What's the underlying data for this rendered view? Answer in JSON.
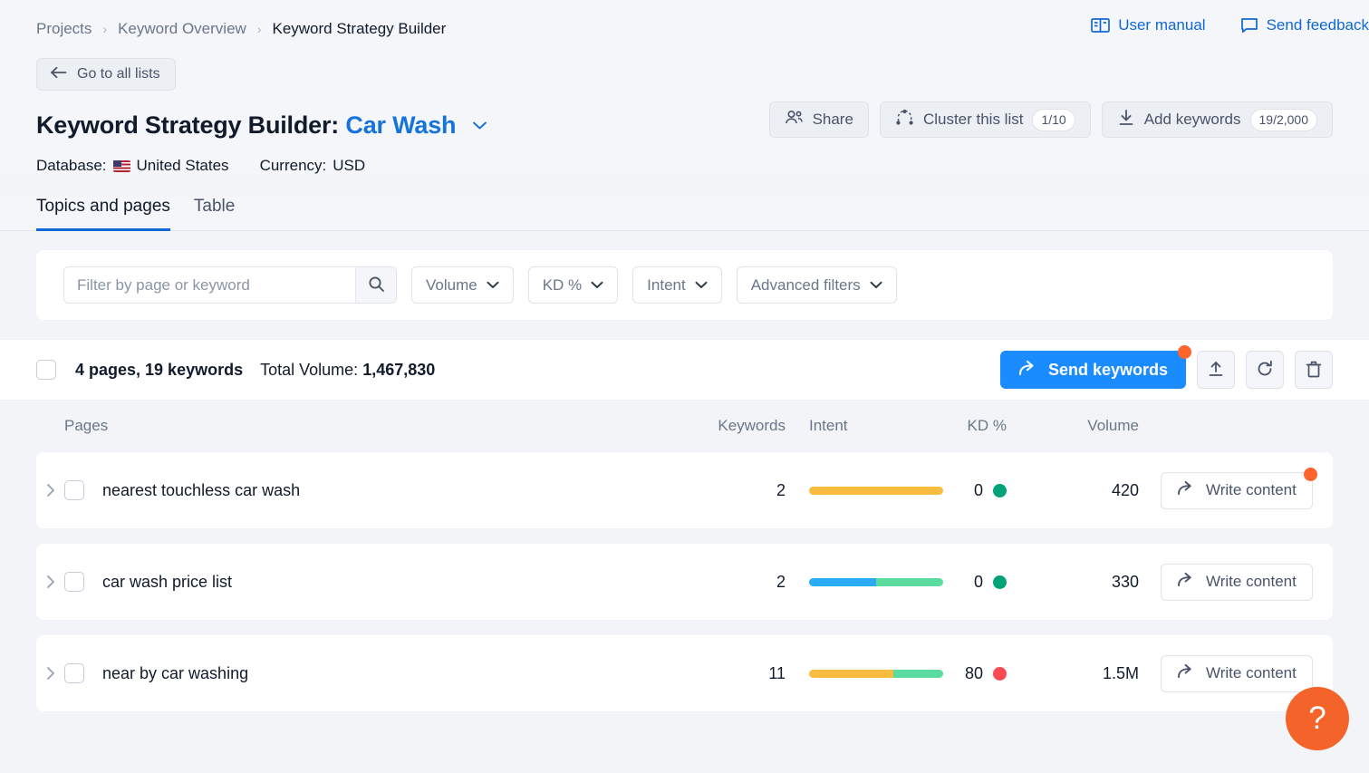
{
  "breadcrumb": {
    "items": [
      "Projects",
      "Keyword Overview",
      "Keyword Strategy Builder"
    ],
    "separator": "›"
  },
  "header": {
    "user_manual": "User manual",
    "send_feedback": "Send feedback",
    "go_back": "Go to all lists",
    "title_prefix": "Keyword Strategy Builder:",
    "title_list": "Car Wash",
    "actions": {
      "share": "Share",
      "cluster": "Cluster this list",
      "cluster_badge": "1/10",
      "add_keywords": "Add keywords",
      "add_keywords_badge": "19/2,000"
    },
    "meta": {
      "database_label": "Database:",
      "database_value": "United States",
      "currency_label": "Currency:",
      "currency_value": "USD"
    }
  },
  "tabs": [
    {
      "label": "Topics and pages",
      "active": true
    },
    {
      "label": "Table",
      "active": false
    }
  ],
  "filters": {
    "search_placeholder": "Filter by page or keyword",
    "search_value": "",
    "dropdowns": [
      "Volume",
      "KD %",
      "Intent",
      "Advanced filters"
    ]
  },
  "summary": {
    "counts": "4 pages, 19 keywords",
    "total_volume_label": "Total Volume:",
    "total_volume_value": "1,467,830",
    "send_keywords": "Send keywords"
  },
  "table": {
    "columns": [
      "Pages",
      "Keywords",
      "Intent",
      "KD %",
      "Volume"
    ],
    "action_label": "Write content",
    "rows": [
      {
        "page": "nearest touchless car wash",
        "keywords": "2",
        "intent_segments": [
          {
            "color": "#f9bc3f",
            "pct": 100
          }
        ],
        "kd": "0",
        "kd_color": "#01a278",
        "volume": "420",
        "has_notification": true
      },
      {
        "page": "car wash price list",
        "keywords": "2",
        "intent_segments": [
          {
            "color": "#2cabf5",
            "pct": 50
          },
          {
            "color": "#5cdba0",
            "pct": 50
          }
        ],
        "kd": "0",
        "kd_color": "#01a278",
        "volume": "330",
        "has_notification": false
      },
      {
        "page": "near by car washing",
        "keywords": "11",
        "intent_segments": [
          {
            "color": "#f9bc3f",
            "pct": 63
          },
          {
            "color": "#5cdba0",
            "pct": 37
          }
        ],
        "kd": "80",
        "kd_color": "#fc4a52",
        "volume": "1.5M",
        "has_notification": false
      }
    ]
  },
  "help": {
    "label": "?"
  },
  "colors": {
    "accent_blue": "#1a8cff",
    "link_blue": "#0f68d4",
    "notification_orange": "#ff642d",
    "help_orange": "#f4642a"
  }
}
